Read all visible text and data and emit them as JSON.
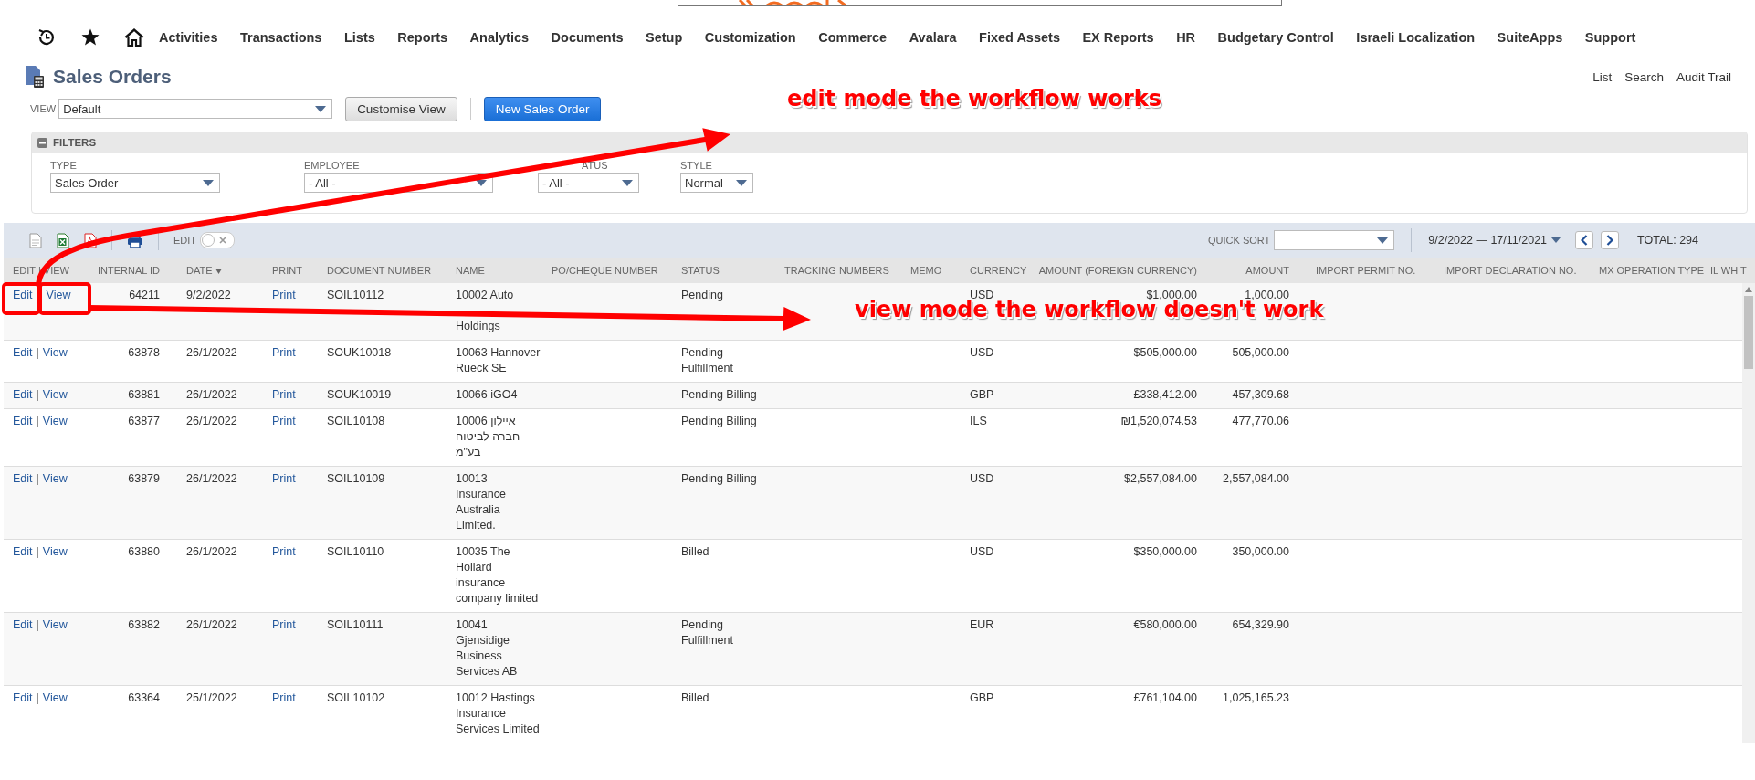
{
  "nav": {
    "items": [
      "Activities",
      "Transactions",
      "Lists",
      "Reports",
      "Analytics",
      "Documents",
      "Setup",
      "Customization",
      "Commerce",
      "Avalara",
      "Fixed Assets",
      "EX Reports",
      "HR",
      "Budgetary Control",
      "Israeli Localization",
      "SuiteApps",
      "Support"
    ]
  },
  "page": {
    "title": "Sales Orders",
    "links": [
      "List",
      "Search",
      "Audit Trail"
    ]
  },
  "view": {
    "label": "VIEW",
    "value": "Default",
    "buttons": [
      {
        "label": "Customise View",
        "kind": "secondary"
      },
      {
        "label": "New Sales Order",
        "kind": "primary"
      }
    ]
  },
  "filters": {
    "title": "FILTERS",
    "expanded": true,
    "fields": [
      {
        "label": "TYPE",
        "value": "Sales Order"
      },
      {
        "label": "EMPLOYEE",
        "value": "- All -"
      },
      {
        "label": "ATUS",
        "value": "- All -"
      },
      {
        "label": "STYLE",
        "value": "Normal"
      }
    ]
  },
  "toolbar": {
    "toggle": {
      "label": "EDIT",
      "on": false
    },
    "quick_sort": {
      "label": "QUICK SORT"
    },
    "range": "9/2/2022 — 17/11/2021",
    "total": "TOTAL: 294"
  },
  "table": {
    "columns": [
      {
        "label": "EDIT | VIEW"
      },
      {
        "label": "INTERNAL ID"
      },
      {
        "label": "DATE",
        "sorted": true
      },
      {
        "label": "PRINT"
      },
      {
        "label": "DOCUMENT NUMBER"
      },
      {
        "label": "NAME"
      },
      {
        "label": "PO/CHEQUE NUMBER"
      },
      {
        "label": "STATUS"
      },
      {
        "label": "TRACKING NUMBERS"
      },
      {
        "label": "MEMO"
      },
      {
        "label": "CURRENCY"
      },
      {
        "label": "AMOUNT (FOREIGN CURRENCY)"
      },
      {
        "label": "AMOUNT"
      },
      {
        "label": "IMPORT PERMIT NO."
      },
      {
        "label": "IMPORT DECLARATION NO."
      },
      {
        "label": "MX OPERATION TYPE"
      },
      {
        "label": "IL WH T"
      }
    ],
    "rows": [
      {
        "edit": "Edit",
        "view": "View",
        "internal_id": "64211",
        "date": "9/2/2022",
        "print": "Print",
        "document_number": "SOIL10112",
        "name": "10002 Auto",
        "name_tail": "Holdings",
        "status": "Pending",
        "currency": "USD",
        "amount_fx": "$1,000.00",
        "amount": "1,000.00"
      },
      {
        "edit": "Edit",
        "separator": "|",
        "view": "View",
        "internal_id": "63878",
        "date": "26/1/2022",
        "print": "Print",
        "document_number": "SOUK10018",
        "name": "10063 Hannover Rueck SE",
        "status": "Pending Fulfillment",
        "currency": "USD",
        "amount_fx": "$505,000.00",
        "amount": "505,000.00"
      },
      {
        "edit": "Edit",
        "separator": "|",
        "view": "View",
        "internal_id": "63881",
        "date": "26/1/2022",
        "print": "Print",
        "document_number": "SOUK10019",
        "name": "10066 iGO4",
        "status": "Pending Billing",
        "currency": "GBP",
        "amount_fx": "£338,412.00",
        "amount": "457,309.68"
      },
      {
        "edit": "Edit",
        "separator": "|",
        "view": "View",
        "internal_id": "63877",
        "date": "26/1/2022",
        "print": "Print",
        "document_number": "SOIL10108",
        "name": "10006 איילון חברה לביטוח בע\"מ",
        "status": "Pending Billing",
        "currency": "ILS",
        "amount_fx": "₪1,520,074.53",
        "amount": "477,770.06"
      },
      {
        "edit": "Edit",
        "separator": "|",
        "view": "View",
        "internal_id": "63879",
        "date": "26/1/2022",
        "print": "Print",
        "document_number": "SOIL10109",
        "name": "10013 Insurance Australia Limited.",
        "status": "Pending Billing",
        "currency": "USD",
        "amount_fx": "$2,557,084.00",
        "amount": "2,557,084.00"
      },
      {
        "edit": "Edit",
        "separator": "|",
        "view": "View",
        "internal_id": "63880",
        "date": "26/1/2022",
        "print": "Print",
        "document_number": "SOIL10110",
        "name": "10035 The Hollard insurance company limited",
        "status": "Billed",
        "currency": "USD",
        "amount_fx": "$350,000.00",
        "amount": "350,000.00"
      },
      {
        "edit": "Edit",
        "separator": "|",
        "view": "View",
        "internal_id": "63882",
        "date": "26/1/2022",
        "print": "Print",
        "document_number": "SOIL10111",
        "name": "10041 Gjensidige Business Services AB",
        "status": "Pending Fulfillment",
        "currency": "EUR",
        "amount_fx": "€580,000.00",
        "amount": "654,329.90"
      },
      {
        "edit": "Edit",
        "separator": "|",
        "view": "View",
        "internal_id": "63364",
        "date": "25/1/2022",
        "print": "Print",
        "document_number": "SOIL10102",
        "name": "10012 Hastings Insurance Services Limited",
        "status": "Billed",
        "currency": "GBP",
        "amount_fx": "£761,104.00",
        "amount": "1,025,165.23"
      }
    ]
  },
  "annotations": [
    {
      "kind": "edit",
      "text": "edit mode the workflow works"
    },
    {
      "kind": "view",
      "text": "view mode the workflow doesn't work"
    }
  ]
}
